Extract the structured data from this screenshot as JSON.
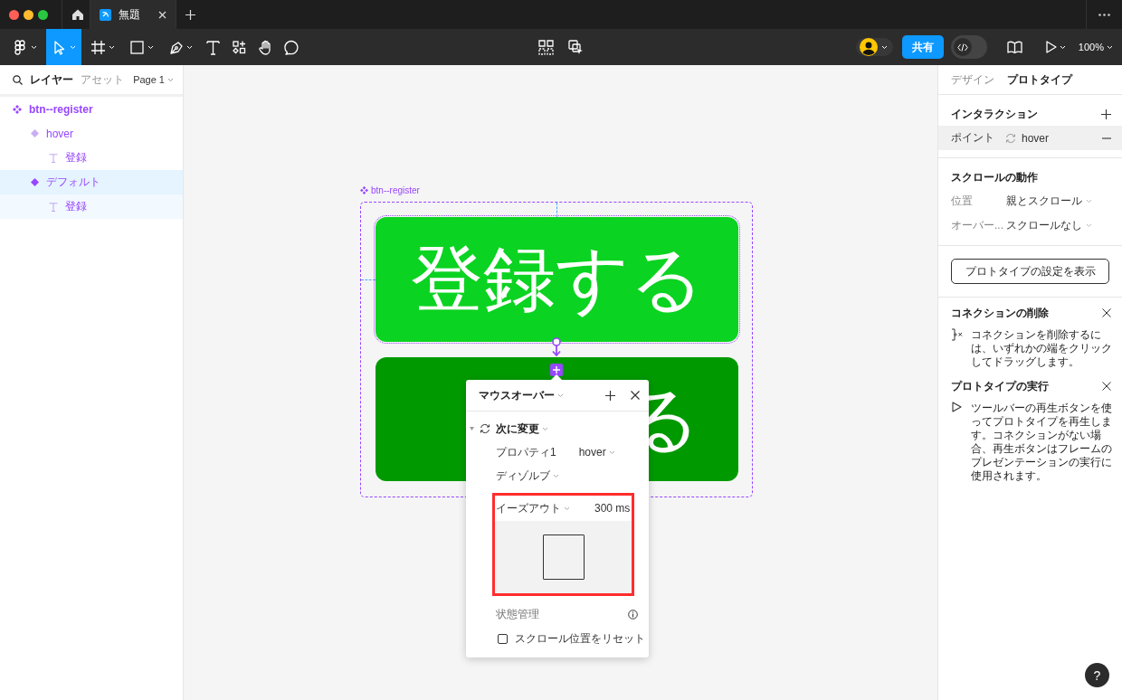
{
  "title_bar": {
    "tabs": [
      {
        "kind": "home",
        "selected": false
      },
      {
        "kind": "file",
        "label": "無題",
        "selected": true
      }
    ]
  },
  "toolbar": {
    "tools": [
      {
        "kind": "main_menu",
        "selected": false
      },
      {
        "kind": "move",
        "selected": true
      },
      {
        "kind": "frame",
        "selected": false
      },
      {
        "kind": "shape",
        "selected": false
      },
      {
        "kind": "pen",
        "selected": false
      },
      {
        "kind": "text",
        "selected": false
      },
      {
        "kind": "actions",
        "selected": false
      },
      {
        "kind": "hand",
        "selected": false
      },
      {
        "kind": "comment",
        "selected": false
      }
    ],
    "share_button": "共有",
    "dev_mode": {
      "on": false
    },
    "zoom": "100%"
  },
  "layers_panel": {
    "tabs": [
      {
        "label": "レイヤー",
        "selected": true
      },
      {
        "label": "アセット",
        "selected": false
      }
    ],
    "page": "Page 1",
    "layers": [
      {
        "name": "btn--register",
        "kind": "component_set",
        "selected": false,
        "children": [
          {
            "name": "hover",
            "kind": "variant",
            "selected": false,
            "children": [
              {
                "name": "登録",
                "kind": "text",
                "selected": false
              }
            ]
          },
          {
            "name": "デフォルト",
            "kind": "variant",
            "selected": true,
            "children": [
              {
                "name": "登録",
                "kind": "text",
                "selected": false
              }
            ]
          }
        ]
      }
    ]
  },
  "canvas": {
    "frame_label": "btn--register",
    "variants": [
      {
        "label": "登録する",
        "color": "#0bd321"
      },
      {
        "label": "る",
        "color": "#009a00"
      }
    ],
    "interaction_popup": {
      "trigger": "マウスオーバー",
      "action": "次に変更",
      "property": {
        "name": "プロパティ1",
        "value": "hover"
      },
      "animation": "ディゾルブ",
      "easing": {
        "label": "イーズアウト",
        "duration": "300 ms",
        "highlighted": true
      },
      "section": "状態管理",
      "reset_scroll": {
        "label": "スクロール位置をリセット",
        "checked": false
      }
    }
  },
  "prototype_panel": {
    "tabs": [
      {
        "label": "デザイン",
        "selected": false
      },
      {
        "label": "プロトタイプ",
        "selected": true
      }
    ],
    "interactions": {
      "title": "インタラクション",
      "items": [
        {
          "trigger": "ポイント",
          "target": "hover",
          "selected": true
        }
      ]
    },
    "scroll": {
      "title": "スクロールの動作",
      "rows": [
        {
          "label": "位置",
          "value": "親とスクロール"
        },
        {
          "label": "オーバー...",
          "value": "スクロールなし"
        }
      ]
    },
    "settings_button": "プロトタイプの設定を表示",
    "tips": [
      {
        "kind": "connection",
        "title": "コネクションの削除",
        "text": "コネクションを削除するには、いずれかの端をクリックしてドラッグします。"
      },
      {
        "kind": "play",
        "title": "プロトタイプの実行",
        "text": "ツールバーの再生ボタンを使ってプロトタイプを再生します。コネクションがない場合、再生ボタンはフレームのプレゼンテーションの実行に使用されます。"
      }
    ]
  },
  "help_button": "?"
}
